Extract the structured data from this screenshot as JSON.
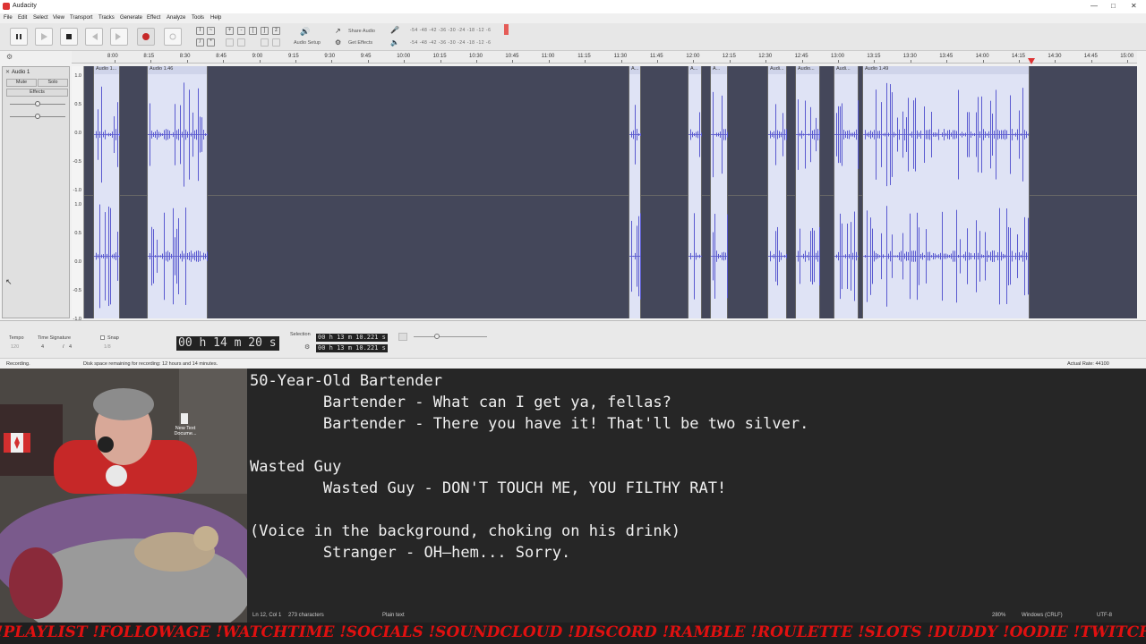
{
  "audacity": {
    "window_title": "Audacity",
    "menu": [
      "File",
      "Edit",
      "Select",
      "View",
      "Transport",
      "Tracks",
      "Generate",
      "Effect",
      "Analyze",
      "Tools",
      "Help"
    ],
    "toolbar": {
      "audio_setup": "Audio Setup",
      "share_audio": "Share Audio",
      "get_effects": "Get Effects",
      "meter_scale": "-54 -48 -42 -36 -30 -24 -18 -12 -6"
    },
    "ruler_ticks": [
      "8:00",
      "8:15",
      "8:30",
      "8:45",
      "9:00",
      "9:15",
      "9:30",
      "9:45",
      "10:00",
      "10:15",
      "10:30",
      "10:45",
      "11:00",
      "11:15",
      "11:30",
      "11:45",
      "12:00",
      "12:15",
      "12:30",
      "12:45",
      "13:00",
      "13:15",
      "13:30",
      "13:45",
      "14:00",
      "14:15",
      "14:30",
      "14:45",
      "15:00"
    ],
    "track": {
      "name": "Audio 1",
      "mute": "Mute",
      "solo": "Solo",
      "effects": "Effects",
      "y_labels": [
        "1.0",
        "0.5",
        "0.0",
        "-0.5",
        "-1.0"
      ]
    },
    "clips": [
      {
        "name": "Audio 1..."
      },
      {
        "name": "Audio 1.46"
      },
      {
        "name": "A..."
      },
      {
        "name": "A..."
      },
      {
        "name": "A..."
      },
      {
        "name": "Audi..."
      },
      {
        "name": "Audio..."
      },
      {
        "name": "Audi..."
      },
      {
        "name": "Audio 1.49"
      }
    ],
    "selection_toolbar": {
      "tempo_label": "Tempo",
      "tempo_value": "120",
      "time_sig_label": "Time Signature",
      "time_sig_num": "4",
      "time_sig_den": "4",
      "snap_label": "Snap",
      "snap_value": "1/8",
      "big_time": "00 h 14 m 20 s",
      "selection_label": "Selection",
      "sel_start": "00 h 13 m 10.221 s",
      "sel_end": "00 h 13 m 10.221 s"
    },
    "status": {
      "state": "Recording.",
      "disk": "Disk space remaining for recording: 12 hours and 14 minutes.",
      "rate": "Actual Rate: 44100"
    }
  },
  "webcam": {
    "desktop_icon_label": "New Text Docume..."
  },
  "notepad": {
    "lines": [
      "50-Year-Old Bartender",
      "        Bartender - What can I get ya, fellas?",
      "        Bartender - There you have it! That'll be two silver.",
      "",
      "Wasted Guy",
      "        Wasted Guy - DON'T TOUCH ME, YOU FILTHY RAT!",
      "",
      "(Voice in the background, choking on his drink)",
      "        Stranger - OH—hem... Sorry."
    ],
    "status": {
      "position": "Ln 12, Col 1",
      "chars": "273 characters",
      "format": "Plain text",
      "zoom": "280%",
      "line_endings": "Windows (CRLF)",
      "encoding": "UTF-8"
    }
  },
  "ticker": {
    "text": "!PLAYLIST !FOLLOWAGE !WATCHTIME !SOCIALS !SOUNDCLOUD !DISCORD !RAMBLE !ROULETTE !SLOTS !DUDDY !OODIE !TWITCH"
  },
  "colors": {
    "track_bg": "#44475a",
    "clip_bg": "#dfe3f5",
    "wave": "#5a5ad0",
    "record": "#c62828",
    "ticker": "#e01010"
  }
}
